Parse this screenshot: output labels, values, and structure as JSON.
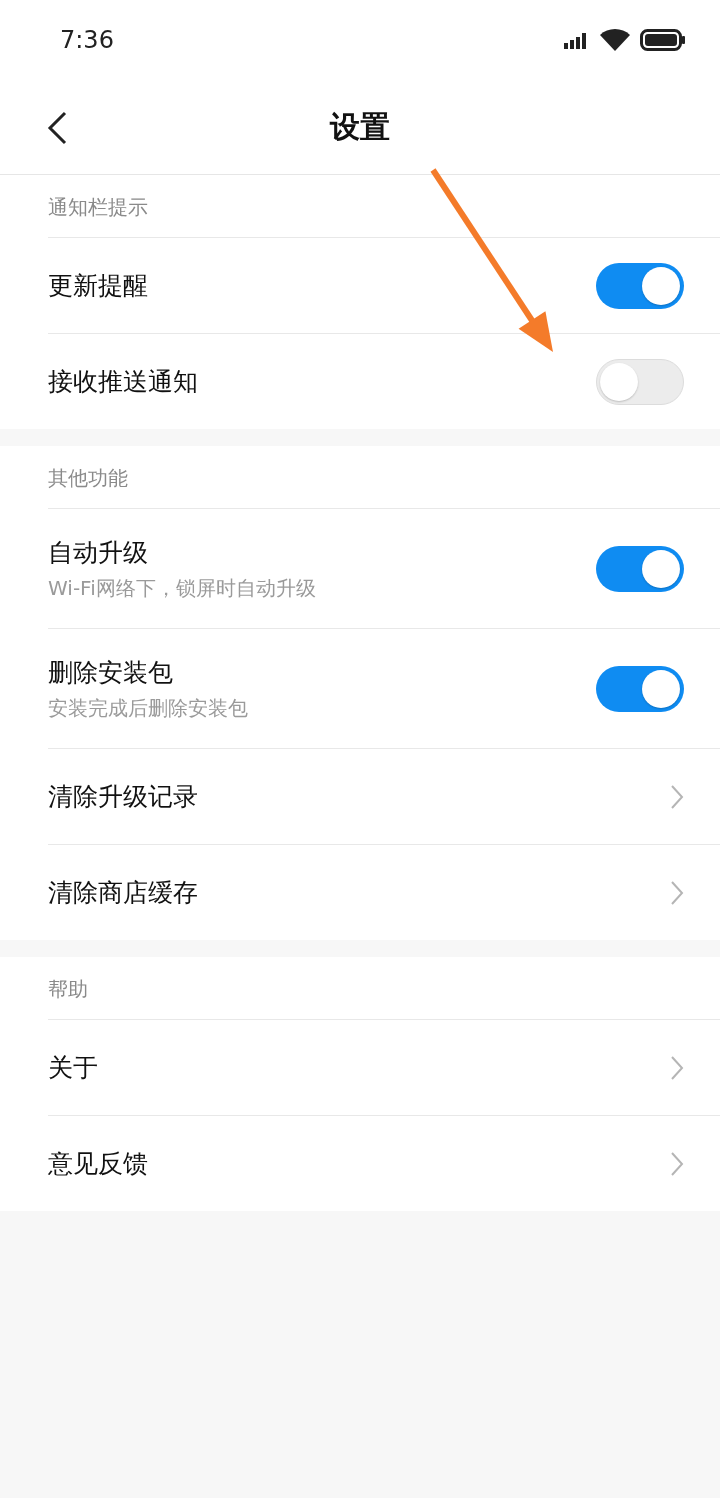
{
  "status_bar": {
    "time": "7:36"
  },
  "header": {
    "title": "设置"
  },
  "sections": [
    {
      "title": "通知栏提示",
      "items": [
        {
          "kind": "toggle",
          "label": "更新提醒",
          "on": true
        },
        {
          "kind": "toggle",
          "label": "接收推送通知",
          "on": false
        }
      ]
    },
    {
      "title": "其他功能",
      "items": [
        {
          "kind": "toggle",
          "label": "自动升级",
          "subtitle": "Wi-Fi网络下，锁屏时自动升级",
          "on": true
        },
        {
          "kind": "toggle",
          "label": "删除安装包",
          "subtitle": "安装完成后删除安装包",
          "on": true
        },
        {
          "kind": "link",
          "label": "清除升级记录"
        },
        {
          "kind": "link",
          "label": "清除商店缓存"
        }
      ]
    },
    {
      "title": "帮助",
      "items": [
        {
          "kind": "link",
          "label": "关于"
        },
        {
          "kind": "link",
          "label": "意见反馈"
        }
      ]
    }
  ],
  "annotation": {
    "kind": "arrow"
  }
}
